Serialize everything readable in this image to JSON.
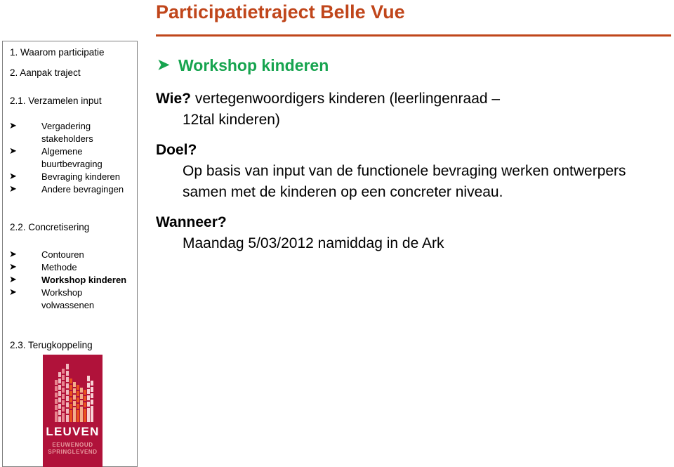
{
  "slide": {
    "title": "Participatietraject Belle Vue",
    "title_color": "#C0461B",
    "rule_color": "#C0461B",
    "accent_green": "#17A44F",
    "logo_red": "#B0123A"
  },
  "sidebar": {
    "headings": {
      "h1": "1. Waarom participatie",
      "h2": "2. Aanpak traject",
      "h3": "2.1. Verzamelen input",
      "h4": "2.2. Concretisering",
      "h5": "2.3. Terugkoppeling"
    },
    "group1": [
      {
        "text": "Vergadering stakeholders",
        "bullet": "arrow-bullet-icon",
        "bold": false
      },
      {
        "text": "Algemene buurtbevraging",
        "bullet": "arrow-bullet-icon",
        "bold": false
      },
      {
        "text": "Bevraging kinderen",
        "bullet": "arrow-bullet-icon",
        "bold": false
      },
      {
        "text": "Andere bevragingen",
        "bullet": "arrow-bullet-icon",
        "bold": false
      }
    ],
    "group2": [
      {
        "text": "Contouren",
        "bullet": "arrow-bullet-icon",
        "bold": false
      },
      {
        "text": "Methode",
        "bullet": "arrow-bullet-icon",
        "bold": false
      },
      {
        "text": "Workshop kinderen",
        "bullet": "arrow-bullet-icon",
        "bold": true
      },
      {
        "text": "Workshop volwassenen",
        "bullet": "arrow-bullet-icon",
        "bold": false
      }
    ],
    "bullet_glyph": "➤"
  },
  "logo": {
    "word": "LEUVEN",
    "tagline_line1": "EEUWENOUD",
    "tagline_line2": "SPRINGLEVEND"
  },
  "content": {
    "heading": "Workshop kinderen",
    "heading_bullet": "➤",
    "wie_label": "Wie?",
    "wie_body": " vertegenwoordigers kinderen (leerlingenraad –",
    "wie_body_cont": "12tal kinderen)",
    "doel_label": "Doel?",
    "doel_body": "Op basis van input van de functionele bevraging werken ontwerpers samen met de kinderen op een concreter niveau.",
    "wanneer_label": "Wanneer?",
    "wanneer_body": "Maandag 5/03/2012 namiddag in de Ark"
  }
}
